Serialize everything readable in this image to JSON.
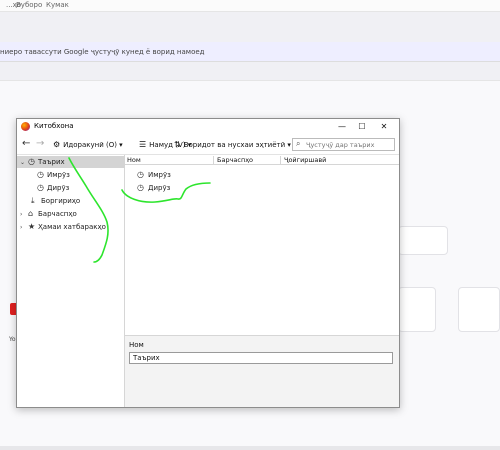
{
  "browser": {
    "menu": [
      "...ҳо",
      "Вуборо",
      "Кумак"
    ],
    "url_text": "ниеро тавассути Google ҷустуҷӯ кунед ё ворид намоед",
    "tile_label": "Yo"
  },
  "library": {
    "title": "Китобхона",
    "window_buttons": {
      "minimize": "—",
      "maximize": "☐",
      "close": "✕"
    },
    "toolbar": {
      "back": "←",
      "forward": "→",
      "organize": "Идоракунӣ (О) ▾",
      "views": "Намуд (V) ▾",
      "import_backup": "Воридот ва нусхаи эҳтиётӣ ▾",
      "search_placeholder": "Ҷустуҷӯ дар таърих"
    },
    "tree": {
      "history": "Таърих",
      "today": "Имрӯз",
      "yesterday": "Дирӯз",
      "downloads": "Боргириҳо",
      "tags": "Барчаспҳо",
      "all_bookmarks": "Ҳамаи хатбаракҳо"
    },
    "columns": {
      "name": "Ном",
      "tags": "Барчаспҳо",
      "location": "Ҷойгиршавӣ"
    },
    "rows": [
      {
        "label": "Имрӯз",
        "icon": "clock-icon"
      },
      {
        "label": "Дирӯз",
        "icon": "clock-icon"
      }
    ],
    "details": {
      "name_label": "Ном",
      "name_value": "Таърих"
    }
  },
  "colors": {
    "annotation_stroke": "#2de52d",
    "selected_row": "#d4d4d4"
  },
  "icons": {
    "history": "clock-icon",
    "downloads": "download-icon",
    "tags": "tag-icon",
    "bookmarks": "star-icon",
    "organize": "gear-icon",
    "views": "view-icon",
    "import": "sort-icon",
    "search": "search-icon"
  }
}
